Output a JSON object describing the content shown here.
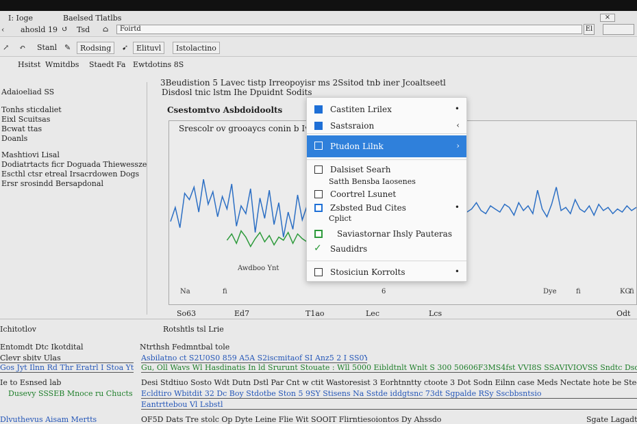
{
  "window": {
    "title_left": "I: Ioge",
    "title_center": "Baelsed Tlatlbs",
    "path_text": "ahosld 19",
    "nav_item": "Tsd",
    "url": "Foirtd",
    "url_btn": "El"
  },
  "toolbar": {
    "items": [
      "Stanl",
      "Rodsing",
      "Elituvl",
      "Istolactino"
    ]
  },
  "breadcrumbs": {
    "items": [
      "Hsitst",
      "Wmitdbs",
      "Staedt Fa",
      "Ewtdotins 8S"
    ]
  },
  "sidebar": {
    "section_title": "Adaioeliad SS",
    "items": [
      "Tonhs sticdaliet",
      "Eixl Scuitsas",
      "Bcwat ttas",
      "Doanls"
    ],
    "group_title": "Mashtiovi Lisal",
    "group_items": [
      "Dodiatrtacts ficr Doguada Thiewessze",
      "Escthl ctsr etreal Irsacrdowen Dogs",
      "Ersr srosindd Bersapdonal"
    ]
  },
  "document": {
    "header_line1": "3Beudistion 5 Lavec tistp Irreopoyisr ms 2Ssitod tnb iner Jcoaltseetl",
    "header_line2": "Disdosl tnic lstm Ihe Dpuidnt Sodits",
    "section_title": "Csestomtvo Asbdoidoolts"
  },
  "chart_data": {
    "type": "line",
    "title": "Srescolr ov grooaycs conin b Iwacanas",
    "annotation": "Awdboo Ynt",
    "series": [
      {
        "color": "#2c6fc4",
        "x": [
          0,
          1,
          2,
          3,
          4,
          5,
          6,
          7,
          8,
          9,
          10,
          11,
          12,
          13,
          14,
          15,
          16,
          17,
          18,
          19,
          20,
          21,
          22,
          23,
          24,
          25,
          26,
          27,
          28,
          29,
          30,
          31,
          32,
          33,
          34,
          35,
          36,
          37,
          38,
          39,
          40,
          41,
          42,
          43,
          44,
          45,
          46,
          47,
          48,
          49,
          50,
          51,
          52,
          53,
          54,
          55,
          56,
          57,
          58,
          59,
          60,
          61,
          62,
          63,
          64,
          65,
          66,
          67,
          68,
          69,
          70,
          71,
          72,
          73,
          74,
          75,
          76,
          77,
          78,
          79,
          80,
          81,
          82,
          83,
          84,
          85,
          86,
          87,
          88,
          89,
          90,
          91,
          92,
          93,
          94,
          95,
          96,
          97,
          98,
          99
        ],
        "y": [
          52,
          61,
          48,
          70,
          66,
          74,
          58,
          79,
          63,
          71,
          55,
          68,
          60,
          76,
          49,
          62,
          57,
          73,
          45,
          67,
          54,
          72,
          50,
          64,
          42,
          58,
          47,
          69,
          53,
          62,
          66,
          75,
          60,
          71,
          57,
          48,
          63,
          55,
          59,
          65,
          54,
          61,
          58,
          67,
          62,
          57,
          60,
          53,
          64,
          59,
          61,
          56,
          63,
          58,
          65,
          60,
          57,
          62,
          59,
          66,
          61,
          55,
          63,
          58,
          60,
          64,
          59,
          57,
          62,
          60,
          58,
          63,
          61,
          56,
          64,
          59,
          62,
          57,
          72,
          60,
          55,
          63,
          74,
          59,
          61,
          57,
          66,
          60,
          58,
          62,
          56,
          63,
          59,
          61,
          57,
          60,
          58,
          62,
          59,
          61
        ]
      },
      {
        "color": "#2c9a3a",
        "x": [
          12,
          13,
          14,
          15,
          16,
          17,
          18,
          19,
          20,
          21,
          22,
          23,
          24,
          25,
          26,
          27,
          28,
          29,
          30,
          31,
          32,
          33,
          34,
          35
        ],
        "y": [
          40,
          44,
          38,
          46,
          42,
          36,
          41,
          45,
          39,
          43,
          37,
          42,
          40,
          45,
          38,
          44,
          41,
          39,
          43,
          40,
          42,
          38,
          41,
          39
        ]
      }
    ],
    "xticks": [
      "So63",
      "Ed7",
      "T1ao",
      "Lec",
      "Lcs",
      "Odt"
    ],
    "inner_ticks": [
      "Na",
      "fi",
      "6",
      "Dye",
      "fi",
      "KG",
      "fi"
    ],
    "ylim": [
      20,
      90
    ],
    "grid": false
  },
  "menu": {
    "items": [
      {
        "label": "Castiten Lrilex",
        "arrow": "•"
      },
      {
        "label": "Sastsraion",
        "arrow": "‹"
      },
      {
        "label": "Ptudon Lilnk",
        "arrow": "›"
      },
      {
        "label": "Dalsiset Searh"
      },
      {
        "label": "Satth Bensba Iaosenes"
      },
      {
        "label": "Coortrel Lsunet"
      },
      {
        "label": "Zsbsted Bud Cites",
        "arrow": "•"
      },
      {
        "label": "Cplict"
      },
      {
        "label": "Saviastornar Ihsly Pauteras"
      },
      {
        "label": "Saudidrs"
      },
      {
        "label": "Stosiciun Korrolts",
        "arrow": "•"
      }
    ]
  },
  "bottom": {
    "left_title": "Ichitotlov",
    "center_title": "Rotshtls tsl Lrie",
    "left_heading": "Entomdt Dtc Ikotdital",
    "left_line1": "Clevr sbitv Ulas",
    "left_line2": "Gos Jyt Ilnn Rd Thr Eratrl I Stoa Ytr",
    "left_line3": "Ie to Esnsed lab",
    "left_line4": "Dusevy SSSEB Mnoce ru Chucts",
    "left_footer": "Dlvuthevus Aisam Mertts",
    "mid_heading": "Ntrthsh Fedmntbal tole",
    "mid_line1": "Asbilatno ct S2U0S0 859 A5A S2iscmitaof SI Anz5 2 I SS0Y",
    "mid_line2": "Gu, Oll Wavs Wl Hasdinatis In ld Srurunt Stouate : Wll 5000 Eibldtnlt Wnlt S 300 50606F3MS4fst VVI8S SSAVIVIOVSS Sndtc Dsdinan",
    "mid_line3": "Desi Stdtiuo Sosto Wdt Dutn Dstl Par Cnt w ctit Wastoresist 3 Eorhtnntty ctoote 3 Dot Sodn Eilnn case Meds Nectate hote be Stedbse",
    "mid_line4": "Ecldtiro Wbitdit 32 Dc Boy Stdotbe Ston 5 9SY Stisens Na Sstde iddgtsnc 73dt Sgpalde RSy Sscbbsntsio",
    "mid_line5": "Eantrttebou Vl Lsbstl",
    "mid_footer": "OF5D Dats Tre stolc Op Dyte Leine Flie Wit SOOIT Flirntiesoiontos Dy Ahssdo",
    "right_footer": "Sgate Lagadt"
  }
}
